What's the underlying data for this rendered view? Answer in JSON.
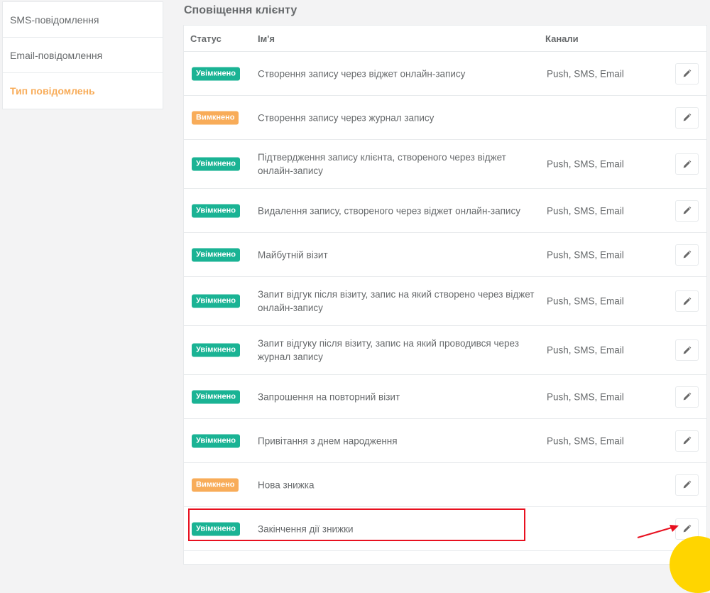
{
  "sidebar": {
    "items": [
      {
        "label": "SMS-повідомлення",
        "active": false
      },
      {
        "label": "Email-повідомлення",
        "active": false
      },
      {
        "label": "Тип повідомлень",
        "active": true
      }
    ]
  },
  "section": {
    "title": "Сповіщення клієнту"
  },
  "table": {
    "headers": {
      "status": "Статус",
      "name": "Ім'я",
      "channels": "Канали"
    },
    "rows": [
      {
        "status": "Увімкнено",
        "state": "on",
        "name": "Створення запису через віджет онлайн-запису",
        "channels": "Push, SMS, Email"
      },
      {
        "status": "Вимкнено",
        "state": "off",
        "name": "Створення запису через журнал запису",
        "channels": ""
      },
      {
        "status": "Увімкнено",
        "state": "on",
        "name": "Підтвердження запису клієнта, створеного через віджет онлайн-запису",
        "channels": "Push, SMS, Email"
      },
      {
        "status": "Увімкнено",
        "state": "on",
        "name": "Видалення запису, створеного через віджет онлайн-запису",
        "channels": "Push, SMS, Email"
      },
      {
        "status": "Увімкнено",
        "state": "on",
        "name": "Майбутній візит",
        "channels": "Push, SMS, Email"
      },
      {
        "status": "Увімкнено",
        "state": "on",
        "name": "Запит відгук після візиту, запис на який створено через віджет онлайн-запису",
        "channels": "Push, SMS, Email"
      },
      {
        "status": "Увімкнено",
        "state": "on",
        "name": "Запит відгуку після візиту, запис на який проводився через журнал запису",
        "channels": "Push, SMS, Email"
      },
      {
        "status": "Увімкнено",
        "state": "on",
        "name": "Запрошення на повторний візит",
        "channels": "Push, SMS, Email"
      },
      {
        "status": "Увімкнено",
        "state": "on",
        "name": "Привітання з днем народження",
        "channels": "Push, SMS, Email"
      },
      {
        "status": "Вимкнено",
        "state": "off",
        "name": "Нова знижка",
        "channels": ""
      },
      {
        "status": "Увімкнено",
        "state": "on",
        "name": "Закінчення дії знижки",
        "channels": ""
      }
    ]
  },
  "icons": {
    "edit": "pencil-icon"
  },
  "colors": {
    "enabled": "#1ab394",
    "disabled": "#f8ac59",
    "active_menu": "#f8ac59",
    "annotation": "#e8101f",
    "accent_circle": "#ffd500"
  }
}
